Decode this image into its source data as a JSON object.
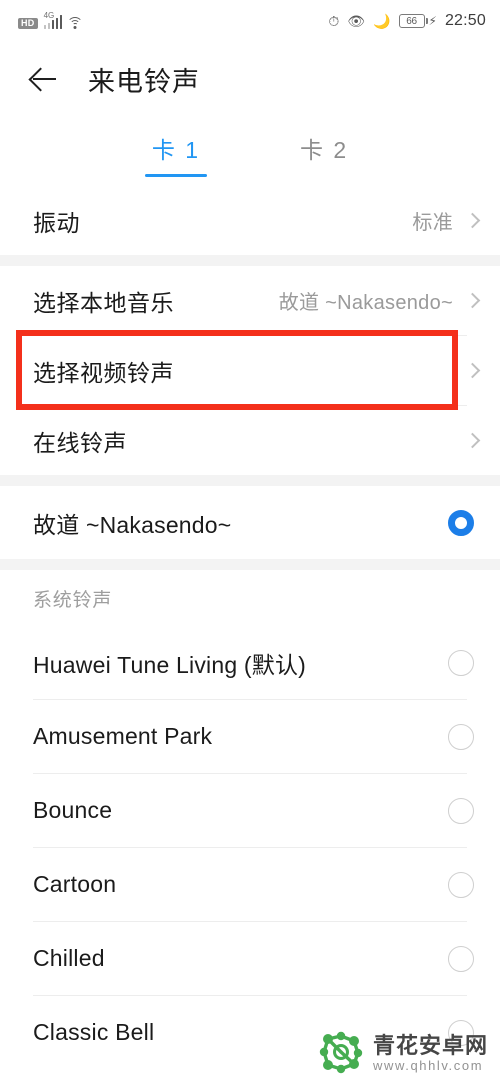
{
  "status_bar": {
    "hd_label": "HD",
    "network_label": "4G",
    "signal_icon": "signal-bars-icon",
    "wifi_icon": "wifi-icon",
    "alarm_icon": "alarm-icon",
    "eye_icon": "eye-comfort-icon",
    "moon_icon": "do-not-disturb-moon-icon",
    "battery_level": "66",
    "charging_icon": "charging-bolt-icon",
    "time": "22:50"
  },
  "header": {
    "back_icon": "back-arrow-icon",
    "title": "来电铃声"
  },
  "tabs": [
    {
      "label": "卡 1",
      "active": true
    },
    {
      "label": "卡 2",
      "active": false
    }
  ],
  "settings": {
    "vibration": {
      "label": "振动",
      "value": "标准"
    },
    "local_music": {
      "label": "选择本地音乐",
      "value": "故道 ~Nakasendo~"
    },
    "video_ringtone": {
      "label": "选择视频铃声",
      "value": ""
    },
    "online_ringtone": {
      "label": "在线铃声",
      "value": ""
    }
  },
  "current_selection": {
    "label": "故道 ~Nakasendo~",
    "selected": true
  },
  "system_section": {
    "header": "系统铃声",
    "items": [
      {
        "label": "Huawei Tune Living (默认)",
        "selected": false
      },
      {
        "label": "Amusement Park",
        "selected": false
      },
      {
        "label": "Bounce",
        "selected": false
      },
      {
        "label": "Cartoon",
        "selected": false
      },
      {
        "label": "Chilled",
        "selected": false
      },
      {
        "label": "Classic Bell",
        "selected": false
      }
    ]
  },
  "highlight": {
    "color": "#f4301b",
    "target": "选择视频铃声"
  },
  "watermark": {
    "logo_icon": "qhhlv-molecule-logo-icon",
    "site_name": "青花安卓网",
    "url": "www.qhhlv.com"
  },
  "colors": {
    "accent_blue": "#2196f3",
    "radio_blue": "#1c7ee8",
    "highlight_red": "#f4301b",
    "background": "#ffffff",
    "separator": "#f3f3f3"
  }
}
